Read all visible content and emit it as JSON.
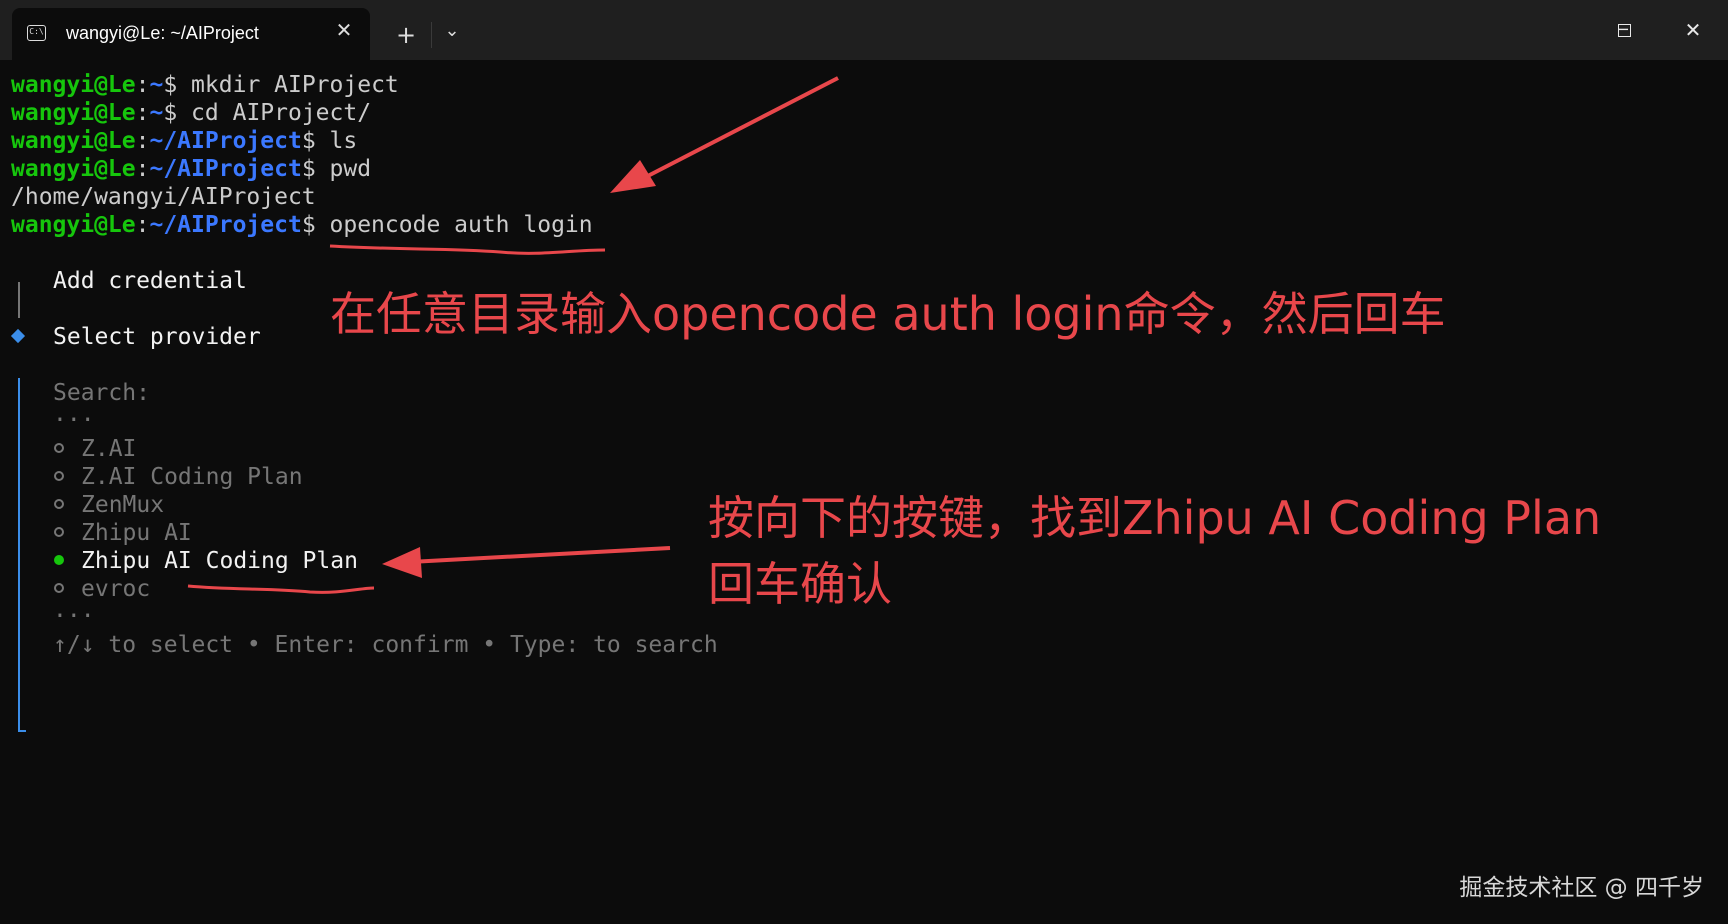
{
  "window": {
    "tab_title": "wangyi@Le: ~/AIProject",
    "tab_icon_text": "C:\\",
    "new_tab_symbol": "+",
    "dropdown_symbol": "⌄",
    "close_tab_symbol": "✕",
    "minimize_symbol": "─",
    "maximize_symbol": "☐",
    "close_symbol": "✕"
  },
  "terminal": {
    "lines": [
      {
        "user": "wangyi@Le",
        "sep": ":",
        "path": "~",
        "prompt": "$",
        "cmd": " mkdir AIProject"
      },
      {
        "user": "wangyi@Le",
        "sep": ":",
        "path": "~",
        "prompt": "$",
        "cmd": " cd AIProject/"
      },
      {
        "user": "wangyi@Le",
        "sep": ":",
        "path": "~/AIProject",
        "prompt": "$",
        "cmd": " ls"
      },
      {
        "user": "wangyi@Le",
        "sep": ":",
        "path": "~/AIProject",
        "prompt": "$",
        "cmd": " pwd"
      }
    ],
    "pwd_output": "/home/wangyi/AIProject",
    "last_line": {
      "user": "wangyi@Le",
      "sep": ":",
      "path": "~/AIProject",
      "prompt": "$",
      "cmd": " opencode auth login"
    },
    "add_credential": "Add credential",
    "select_provider": "Select provider",
    "search_label": "Search:",
    "ellipsis_top": "...",
    "providers": [
      {
        "label": "Z.AI",
        "selected": false
      },
      {
        "label": "Z.AI Coding Plan",
        "selected": false
      },
      {
        "label": "ZenMux",
        "selected": false
      },
      {
        "label": "Zhipu AI",
        "selected": false
      },
      {
        "label": "Zhipu AI Coding Plan",
        "selected": true
      },
      {
        "label": "evroc",
        "selected": false
      }
    ],
    "ellipsis_bottom": "...",
    "hint": "↑/↓ to select • Enter: confirm • Type: to search"
  },
  "annotations": {
    "step1": "在任意目录输入opencode auth login命令，然后回车",
    "step2_line1": "按向下的按键，找到Zhipu AI Coding Plan",
    "step2_line2": "回车确认",
    "color": "#e8474b"
  },
  "watermark": "掘金技术社区 @ 四千岁",
  "colors": {
    "background": "#0c0c0c",
    "user_green": "#16c60c",
    "path_blue": "#3b78ff",
    "text": "#cccccc",
    "dim": "#767676"
  }
}
